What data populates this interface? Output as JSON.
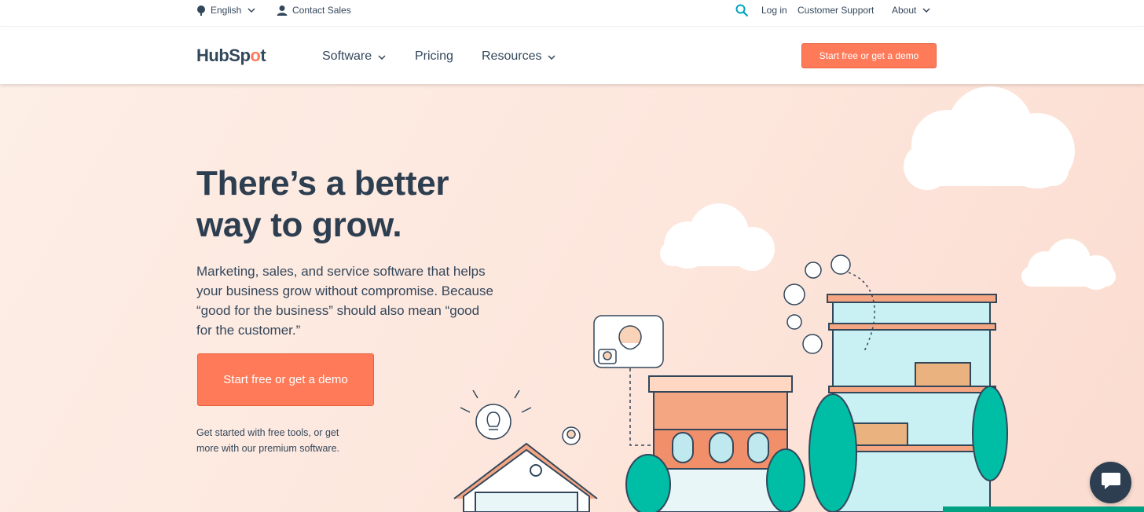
{
  "utility": {
    "language": "English",
    "contact": "Contact Sales",
    "login": "Log in",
    "support": "Customer Support",
    "about": "About"
  },
  "nav": {
    "logo_text_pre": "HubSp",
    "logo_text_o": "o",
    "logo_text_post": "t",
    "items": [
      "Software",
      "Pricing",
      "Resources"
    ],
    "cta": "Start free or get a demo"
  },
  "hero": {
    "headline_line1": "There’s a better",
    "headline_line2": "way to grow.",
    "subtext": "Marketing, sales, and service software that helps your business grow without compromise. Because “good for the business” should also mean “good for the customer.”",
    "cta": "Start free or get a demo",
    "note": "Get started with free tools, or get more with our premium software."
  },
  "colors": {
    "accent": "#ff7a59",
    "text": "#33475b",
    "heading": "#2d3e50",
    "hero_bg": "#fde6dc",
    "teal": "#00bda5"
  },
  "icons": [
    "globe-icon",
    "contact-person-icon",
    "search-icon",
    "chevron-down-icon",
    "chat-icon"
  ]
}
